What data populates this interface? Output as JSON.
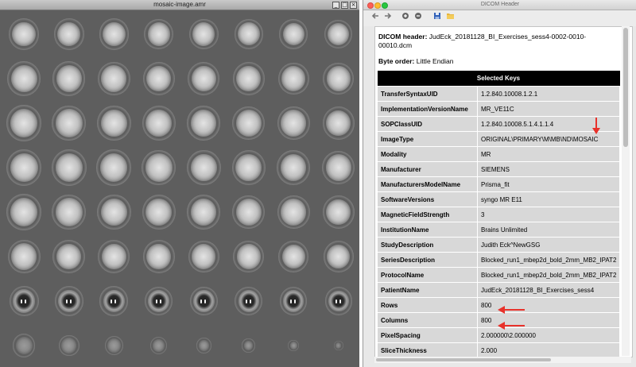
{
  "left_window": {
    "title": "mosaic-image.amr"
  },
  "right_window": {
    "title": "DICOM Header",
    "header_label": "DICOM header:",
    "file_name": "JudEck_20181128_BI_Exercises_sess4-0002-0010-00010.dcm",
    "byte_order_label": "Byte order:",
    "byte_order": "Little Endian",
    "table_title": "Selected Keys",
    "rows": [
      {
        "key": "TransferSyntaxUID",
        "value": "1.2.840.10008.1.2.1"
      },
      {
        "key": "ImplementationVersionName",
        "value": "MR_VE11C"
      },
      {
        "key": "SOPClassUID",
        "value": "1.2.840.10008.5.1.4.1.1.4"
      },
      {
        "key": "ImageType",
        "value": "ORIGINAL\\PRIMARY\\M\\MB\\ND\\MOSAIC"
      },
      {
        "key": "Modality",
        "value": "MR"
      },
      {
        "key": "Manufacturer",
        "value": "SIEMENS"
      },
      {
        "key": "ManufacturersModelName",
        "value": "Prisma_fit"
      },
      {
        "key": "SoftwareVersions",
        "value": "syngo MR E11"
      },
      {
        "key": "MagneticFieldStrength",
        "value": "3"
      },
      {
        "key": "InstitutionName",
        "value": "Brains Unlimited"
      },
      {
        "key": "StudyDescription",
        "value": "Judith Eck^NewGSG"
      },
      {
        "key": "SeriesDescription",
        "value": "Blocked_run1_mbep2d_bold_2mm_MB2_IPAT2"
      },
      {
        "key": "ProtocolName",
        "value": "Blocked_run1_mbep2d_bold_2mm_MB2_IPAT2"
      },
      {
        "key": "PatientName",
        "value": "JudEck_20181128_BI_Exercises_sess4"
      },
      {
        "key": "Rows",
        "value": "800"
      },
      {
        "key": "Columns",
        "value": "800"
      },
      {
        "key": "PixelSpacing",
        "value": "2.000000\\2.000000"
      },
      {
        "key": "SliceThickness",
        "value": "2.000"
      }
    ]
  },
  "colors": {
    "mosaic_background": "#5e5e5e",
    "annotation_arrow": "#e8322b",
    "table_header": "#000000",
    "table_cell": "#d8d8d8"
  }
}
